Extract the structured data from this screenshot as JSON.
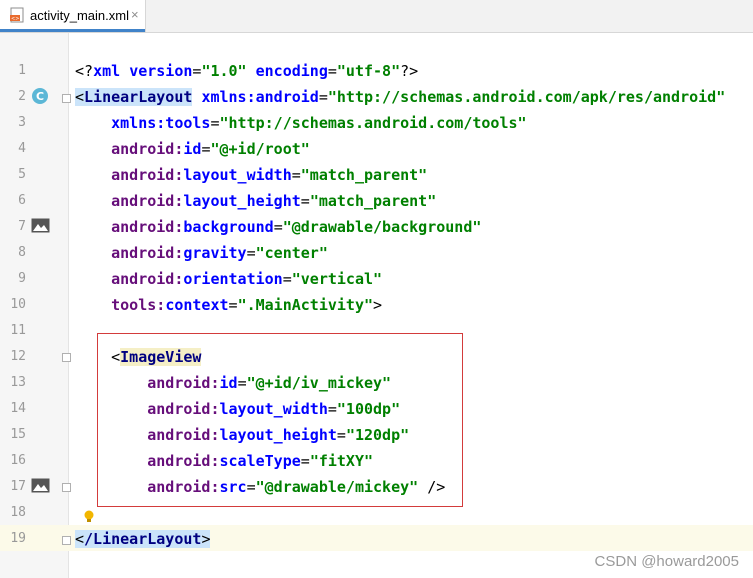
{
  "tab": {
    "title": "activity_main.xml",
    "close": "×"
  },
  "lines": [
    {
      "n": "1",
      "text": [
        "<?",
        "xml ",
        "version",
        "=",
        "\"1.0\"",
        " ",
        "encoding",
        "=",
        "\"utf-8\"",
        "?>"
      ]
    },
    {
      "n": "2"
    },
    {
      "n": "3"
    },
    {
      "n": "4"
    },
    {
      "n": "5"
    },
    {
      "n": "6"
    },
    {
      "n": "7"
    },
    {
      "n": "8"
    },
    {
      "n": "9"
    },
    {
      "n": "10"
    },
    {
      "n": "11"
    },
    {
      "n": "12"
    },
    {
      "n": "13"
    },
    {
      "n": "14"
    },
    {
      "n": "15"
    },
    {
      "n": "16"
    },
    {
      "n": "17"
    },
    {
      "n": "18"
    },
    {
      "n": "19"
    }
  ],
  "code": {
    "l1_open": "<?",
    "l1_xml": "xml",
    "l1_version_attr": "version",
    "l1_version_val": "\"1.0\"",
    "l1_encoding_attr": "encoding",
    "l1_encoding_val": "\"utf-8\"",
    "l1_close": "?>",
    "l2_tag": "LinearLayout",
    "l2_attr": "xmlns:android",
    "l2_val": "\"http://schemas.android.com/apk/res/android\"",
    "l3_attr": "xmlns:tools",
    "l3_val": "\"http://schemas.android.com/tools\"",
    "l4_ns": "android",
    "l4_attr": "id",
    "l4_val": "\"@+id/root\"",
    "l5_ns": "android",
    "l5_attr": "layout_width",
    "l5_val": "\"match_parent\"",
    "l6_ns": "android",
    "l6_attr": "layout_height",
    "l6_val": "\"match_parent\"",
    "l7_ns": "android",
    "l7_attr": "background",
    "l7_val": "\"@drawable/background\"",
    "l8_ns": "android",
    "l8_attr": "gravity",
    "l8_val": "\"center\"",
    "l9_ns": "android",
    "l9_attr": "orientation",
    "l9_val": "\"vertical\"",
    "l10_ns": "tools",
    "l10_attr": "context",
    "l10_val": "\".MainActivity\"",
    "l12_tag": "ImageView",
    "l13_ns": "android",
    "l13_attr": "id",
    "l13_val": "\"@+id/iv_mickey\"",
    "l14_ns": "android",
    "l14_attr": "layout_width",
    "l14_val": "\"100dp\"",
    "l15_ns": "android",
    "l15_attr": "layout_height",
    "l15_val": "\"120dp\"",
    "l16_ns": "android",
    "l16_attr": "scaleType",
    "l16_val": "\"fitXY\"",
    "l17_ns": "android",
    "l17_attr": "src",
    "l17_val": "\"@drawable/mickey\"",
    "l17_close": " />",
    "l19_tag": "/LinearLayout"
  },
  "gutter_icons": {
    "class_badge": "C"
  },
  "watermark": "CSDN @howard2005",
  "colors": {
    "tag": "#000080",
    "attr": "#0000ff",
    "ns": "#660e7a",
    "string": "#008000",
    "highlight": "#cbe4fa",
    "box": "#d33b3b"
  }
}
